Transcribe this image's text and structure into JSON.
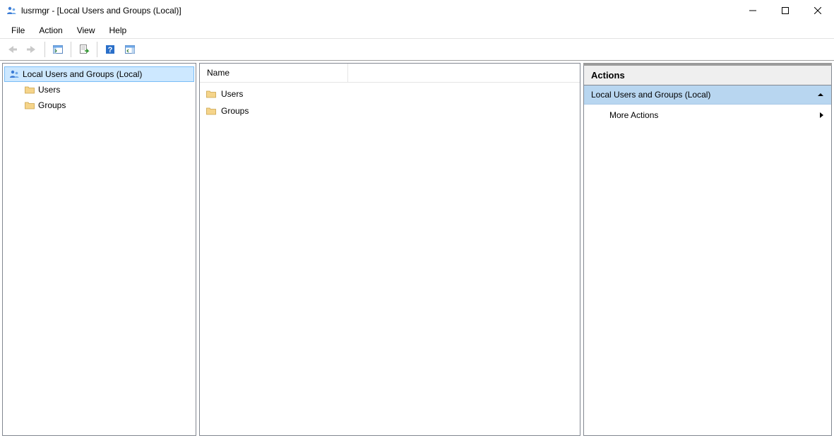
{
  "window": {
    "title": "lusrmgr - [Local Users and Groups (Local)]"
  },
  "menu": {
    "file": "File",
    "action": "Action",
    "view": "View",
    "help": "Help"
  },
  "tree": {
    "root": "Local Users and Groups (Local)",
    "children": [
      {
        "label": "Users"
      },
      {
        "label": "Groups"
      }
    ]
  },
  "list": {
    "columns": {
      "name": "Name"
    },
    "rows": [
      {
        "name": "Users"
      },
      {
        "name": "Groups"
      }
    ]
  },
  "actions": {
    "title": "Actions",
    "group_header": "Local Users and Groups (Local)",
    "more_actions": "More Actions"
  }
}
